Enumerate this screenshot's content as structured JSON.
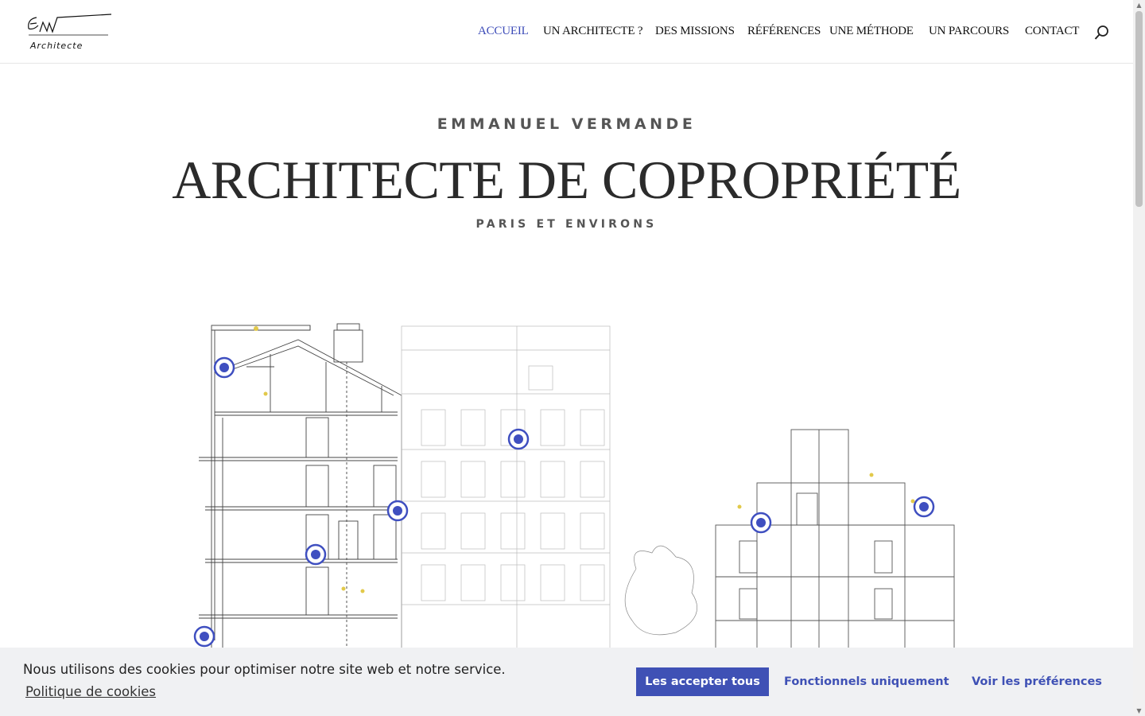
{
  "header": {
    "logo_alt": "EMV Architecte",
    "logo_script": "EmV",
    "logo_sub": "Architecte",
    "nav": [
      {
        "label": "ACCUEIL",
        "active": true
      },
      {
        "label": "UN ARCHITECTE ?",
        "active": false
      },
      {
        "label": "DES MISSIONS",
        "active": false
      },
      {
        "label": "RÉFÉRENCES",
        "active": false
      },
      {
        "label": "UNE MÉTHODE",
        "active": false
      },
      {
        "label": "UN PARCOURS",
        "active": false
      },
      {
        "label": "CONTACT",
        "active": false
      }
    ],
    "search_icon": "search-icon"
  },
  "hero": {
    "name": "EMMANUEL VERMANDE",
    "title": "ARCHITECTE DE COPROPRIÉTÉ",
    "subtitle": "PARIS ET ENVIRONS"
  },
  "cookie_banner": {
    "message": "Nous utilisons des cookies pour optimiser notre site web et notre service.",
    "policy_link": "Politique de cookies",
    "accept_all": "Les accepter tous",
    "functional_only": "Fonctionnels uniquement",
    "preferences": "Voir les préférences"
  },
  "colors": {
    "accent": "#3f51b5",
    "nav_active": "#3c4bb8",
    "hotspot": "#3f4fc0",
    "banner_bg": "#f0f1f3"
  }
}
